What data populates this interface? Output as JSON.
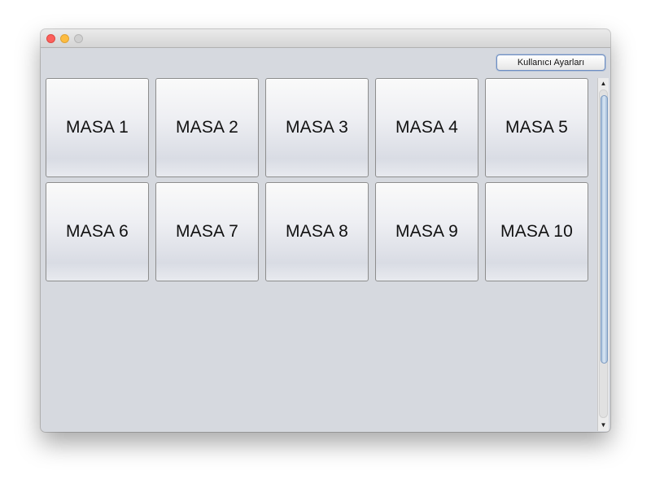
{
  "toolbar": {
    "settings_label": "Kullanıcı Ayarları"
  },
  "tables": [
    {
      "label": "MASA 1"
    },
    {
      "label": "MASA 2"
    },
    {
      "label": "MASA 3"
    },
    {
      "label": "MASA 4"
    },
    {
      "label": "MASA 5"
    },
    {
      "label": "MASA 6"
    },
    {
      "label": "MASA 7"
    },
    {
      "label": "MASA 8"
    },
    {
      "label": "MASA 9"
    },
    {
      "label": "MASA 10"
    }
  ],
  "scrollbar": {
    "up_icon": "arrow-up-icon",
    "down_icon": "arrow-down-icon"
  },
  "colors": {
    "window_background": "#d6d9df",
    "close_button": "#fc605c",
    "minimize_button": "#fdbc40",
    "zoom_button": "#d0d0d0"
  }
}
